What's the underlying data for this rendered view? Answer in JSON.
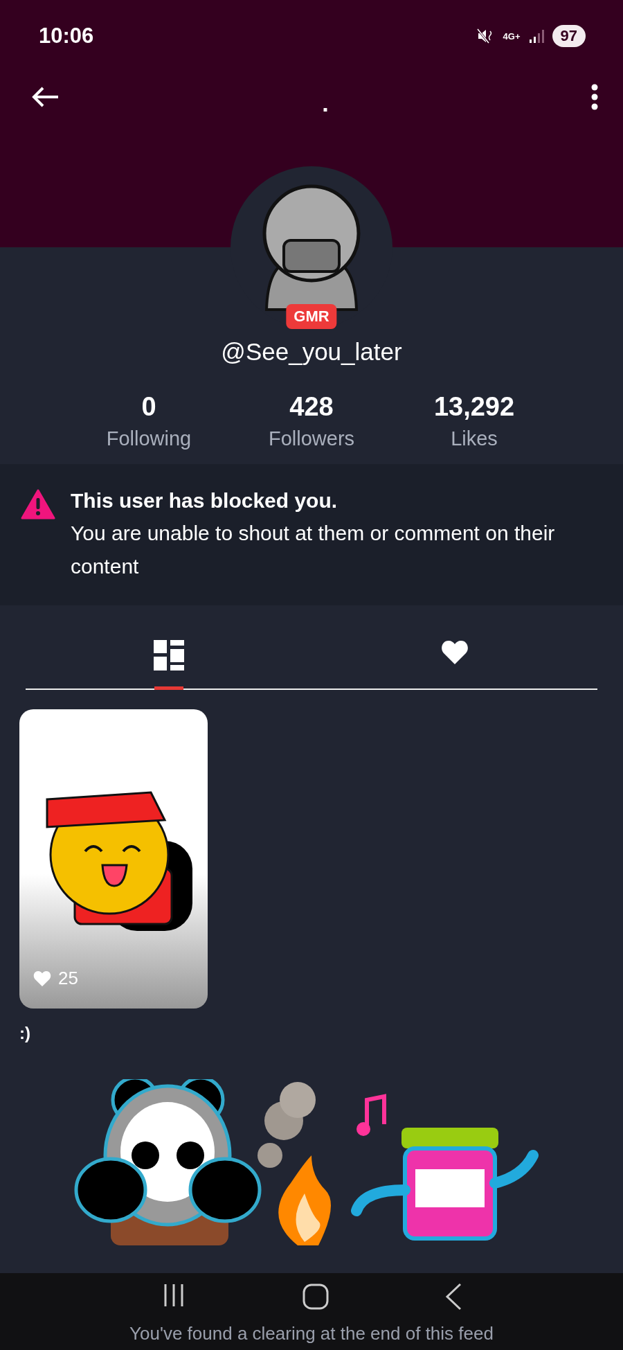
{
  "status_bar": {
    "time": "10:06",
    "network": "4G+",
    "battery": "97"
  },
  "header": {
    "title": "."
  },
  "profile": {
    "badge": "GMR",
    "username": "@See_you_later"
  },
  "stats": [
    {
      "value": "0",
      "label": "Following"
    },
    {
      "value": "428",
      "label": "Followers"
    },
    {
      "value": "13,292",
      "label": "Likes"
    }
  ],
  "notice": {
    "title": "This user has blocked you.",
    "message": "You are unable to shout at them or comment on their content"
  },
  "tabs": [
    {
      "kind": "grid",
      "selected": true
    },
    {
      "kind": "likes",
      "selected": false
    }
  ],
  "posts": [
    {
      "likes": "25",
      "caption": ":)"
    }
  ],
  "feed_end": "You've found a clearing at the end of this feed"
}
